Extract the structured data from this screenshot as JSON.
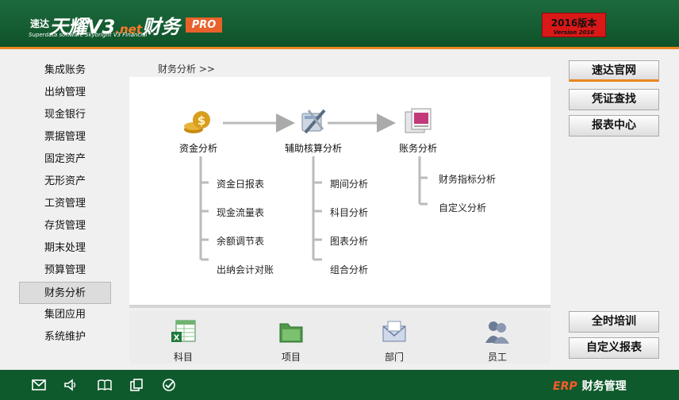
{
  "header": {
    "logo_prefix": "速达",
    "logo_main": "天耀V3",
    "logo_net": ".net",
    "logo_suffix": "财务",
    "logo_sub": "Superdata software Skybright V3 Financial",
    "pro_badge": "PRO",
    "version_main": "2016版本",
    "version_sub": "Version 2016"
  },
  "sidebar": {
    "items": [
      {
        "label": "集成账务"
      },
      {
        "label": "出纳管理"
      },
      {
        "label": "现金银行"
      },
      {
        "label": "票据管理"
      },
      {
        "label": "固定资产"
      },
      {
        "label": "无形资产"
      },
      {
        "label": "工资管理"
      },
      {
        "label": "存货管理"
      },
      {
        "label": "期末处理"
      },
      {
        "label": "预算管理"
      },
      {
        "label": "财务分析"
      },
      {
        "label": "集团应用"
      },
      {
        "label": "系统维护"
      }
    ],
    "active": "财务分析"
  },
  "breadcrumb": "财务分析 >>",
  "flow": {
    "nodes": [
      {
        "label": "资金分析",
        "icon": "coins-icon"
      },
      {
        "label": "辅助核算分析",
        "icon": "tools-icon"
      },
      {
        "label": "账务分析",
        "icon": "document-analysis-icon"
      }
    ],
    "fund_items": [
      "资金日报表",
      "现金流量表",
      "余额调节表",
      "出纳会计对账"
    ],
    "aux_items": [
      "期间分析",
      "科目分析",
      "图表分析",
      "组合分析"
    ],
    "account_items": [
      "财务指标分析",
      "自定义分析"
    ]
  },
  "bottom": {
    "items": [
      {
        "label": "科目",
        "icon": "spreadsheet-icon"
      },
      {
        "label": "项目",
        "icon": "folder-icon"
      },
      {
        "label": "部门",
        "icon": "envelope-icon"
      },
      {
        "label": "员工",
        "icon": "users-icon"
      }
    ]
  },
  "right_buttons": {
    "top": [
      "速达官网",
      "凭证查找",
      "报表中心"
    ],
    "bottom": [
      "全时培训",
      "自定义报表"
    ]
  },
  "footer": {
    "icons": [
      "mail-icon",
      "speaker-icon",
      "book-icon",
      "copy-icon",
      "check-icon"
    ],
    "brand_erp": "ERP",
    "brand_text": "财务管理"
  },
  "colors": {
    "header_green": "#1d6a3e",
    "accent_orange": "#e8871f",
    "footer_green": "#0f5a2c",
    "version_red": "#d91818"
  }
}
